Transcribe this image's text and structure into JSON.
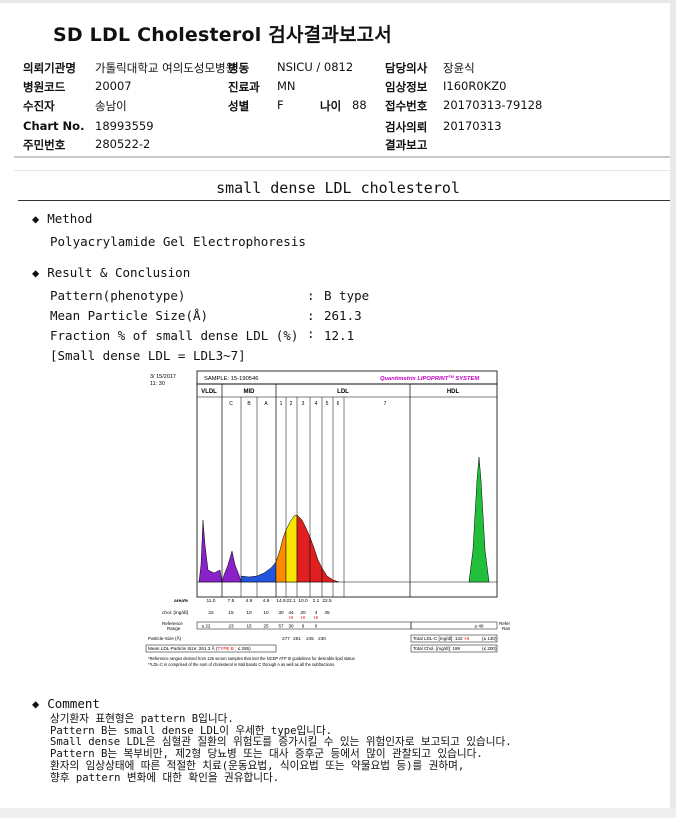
{
  "title": "SD LDL Cholesterol 검사결과보고서",
  "patient_info": {
    "requesting_institution_label": "의뢰기관명",
    "requesting_institution": "가톨릭대학교 여의도성모병원",
    "ward_label": "병동",
    "ward": "NSICU / 0812",
    "doctor_label": "담당의사",
    "doctor": "장윤식",
    "hospital_code_label": "병원코드",
    "hospital_code": "20007",
    "department_label": "진료과",
    "department": "MN",
    "clinical_info_label": "임상정보",
    "clinical_info": "I160R0KZ0",
    "patient_label": "수진자",
    "patient": "송남이",
    "sex_label": "성별",
    "sex": "F",
    "age_label": "나이",
    "age": "88",
    "reception_label": "접수번호",
    "reception": "20170313-79128",
    "chart_label": "Chart No.",
    "chart": "18993559",
    "request_date_label": "검사의뢰",
    "request_date": "20170313",
    "id_label": "주민번호",
    "id": "280522-2",
    "report_label": "결과보고",
    "report": ""
  },
  "section_title": "small dense LDL cholesterol",
  "method": {
    "heading": "Method",
    "text": "Polyacrylamide Gel Electrophoresis"
  },
  "result": {
    "heading": "Result & Conclusion",
    "pattern_label": "Pattern(phenotype)",
    "pattern_value": "B type",
    "size_label": "Mean Particle Size(Å)",
    "size_value": "261.3",
    "fraction_label": "Fraction % of small dense LDL (%)",
    "fraction_value": "12.1",
    "note": "[Small dense LDL = LDL3~7]",
    "colon": ":"
  },
  "chart_header": {
    "date": "3/ 15/2017",
    "time": "11: 30",
    "sample": "SAMPLE:  15-190546",
    "brand": "Quantimetrix LIPOPRINT",
    "brand_sup": "TM",
    "brand_suffix": " SYSTEM",
    "band_groups": [
      "VLDL",
      "MID",
      "LDL",
      "HDL"
    ],
    "mid_bands": [
      "C",
      "B",
      "A"
    ],
    "ldl_bands": [
      "1",
      "2",
      "3",
      "4",
      "5",
      "6",
      "7"
    ]
  },
  "chart_data": {
    "type": "area",
    "title": "",
    "xlabel": "",
    "ylabel": "",
    "row_labels": {
      "area": "area%",
      "chol": "chol. [mg/dl]",
      "reference": "Reference\nRange",
      "particle": "Particle-Size (Å)",
      "mean": "Mean LDL-Particle Size:  261.3 Å",
      "type_label": "TYPE B",
      "mean_suffix": "(≤ 265)"
    },
    "area_values": [
      "11.0",
      "7.5",
      "4.9",
      "4.9",
      "14.9",
      "22.1",
      "10.0",
      "2.1",
      "22.5"
    ],
    "chol_values": [
      "22",
      "15",
      "10",
      "10",
      "30",
      "44",
      "20",
      "4",
      "45"
    ],
    "hi_flags": [
      "HI",
      "HI",
      "HI"
    ],
    "reference_values": [
      "≤ 22",
      "23",
      "15",
      "25",
      "57",
      "30",
      "6",
      "0",
      "≥ 40"
    ],
    "particle_sizes": [
      "277",
      "261",
      "245",
      "230"
    ],
    "total_ldl": "Total LDL-C [mg/dl]:  132",
    "total_ldl_flag": "HI",
    "total_ldl_ref": "(≤ 130)",
    "total_chol": "Total Chol. [mg/dl]:  199",
    "total_chol_ref": "(≤ 200)",
    "footnote1": "*Reference ranges derived from 125 serum samples that met the NCEP ATP III guidelines for desirable lipid status",
    "footnote2": "**LDL-C is comprised of the sum of cholesterol in Mid bands C through A as well as all the subfractions",
    "colors": {
      "vldl": "#8a20c8",
      "mid": "#2255dd",
      "ldl1": "#ff8c00",
      "ldl2": "#f5e500",
      "ldl3": "#e02020",
      "hdl": "#22c03a",
      "brand": "#c400c4"
    }
  },
  "comment": {
    "heading": "Comment",
    "lines": [
      "상기환자 표현형은 pattern B입니다.",
      "Pattern B는 small dense LDL이 우세한 type입니다.",
      "Small dense LDL은 심혈관 질환의 위험도를 증가시킬 수 있는 위험인자로 보고되고 있습니다.",
      "Pattern B는 복부비만, 제2형 당뇨병 또는 대사 증후군 등에서 많이 관찰되고 있습니다.",
      "환자의 임상상태에 따른 적절한 치료(운동요법, 식이요법 또는 약물요법 등)를 권하며,",
      "향후 pattern 변화에 대한 확인을 권유합니다."
    ]
  }
}
